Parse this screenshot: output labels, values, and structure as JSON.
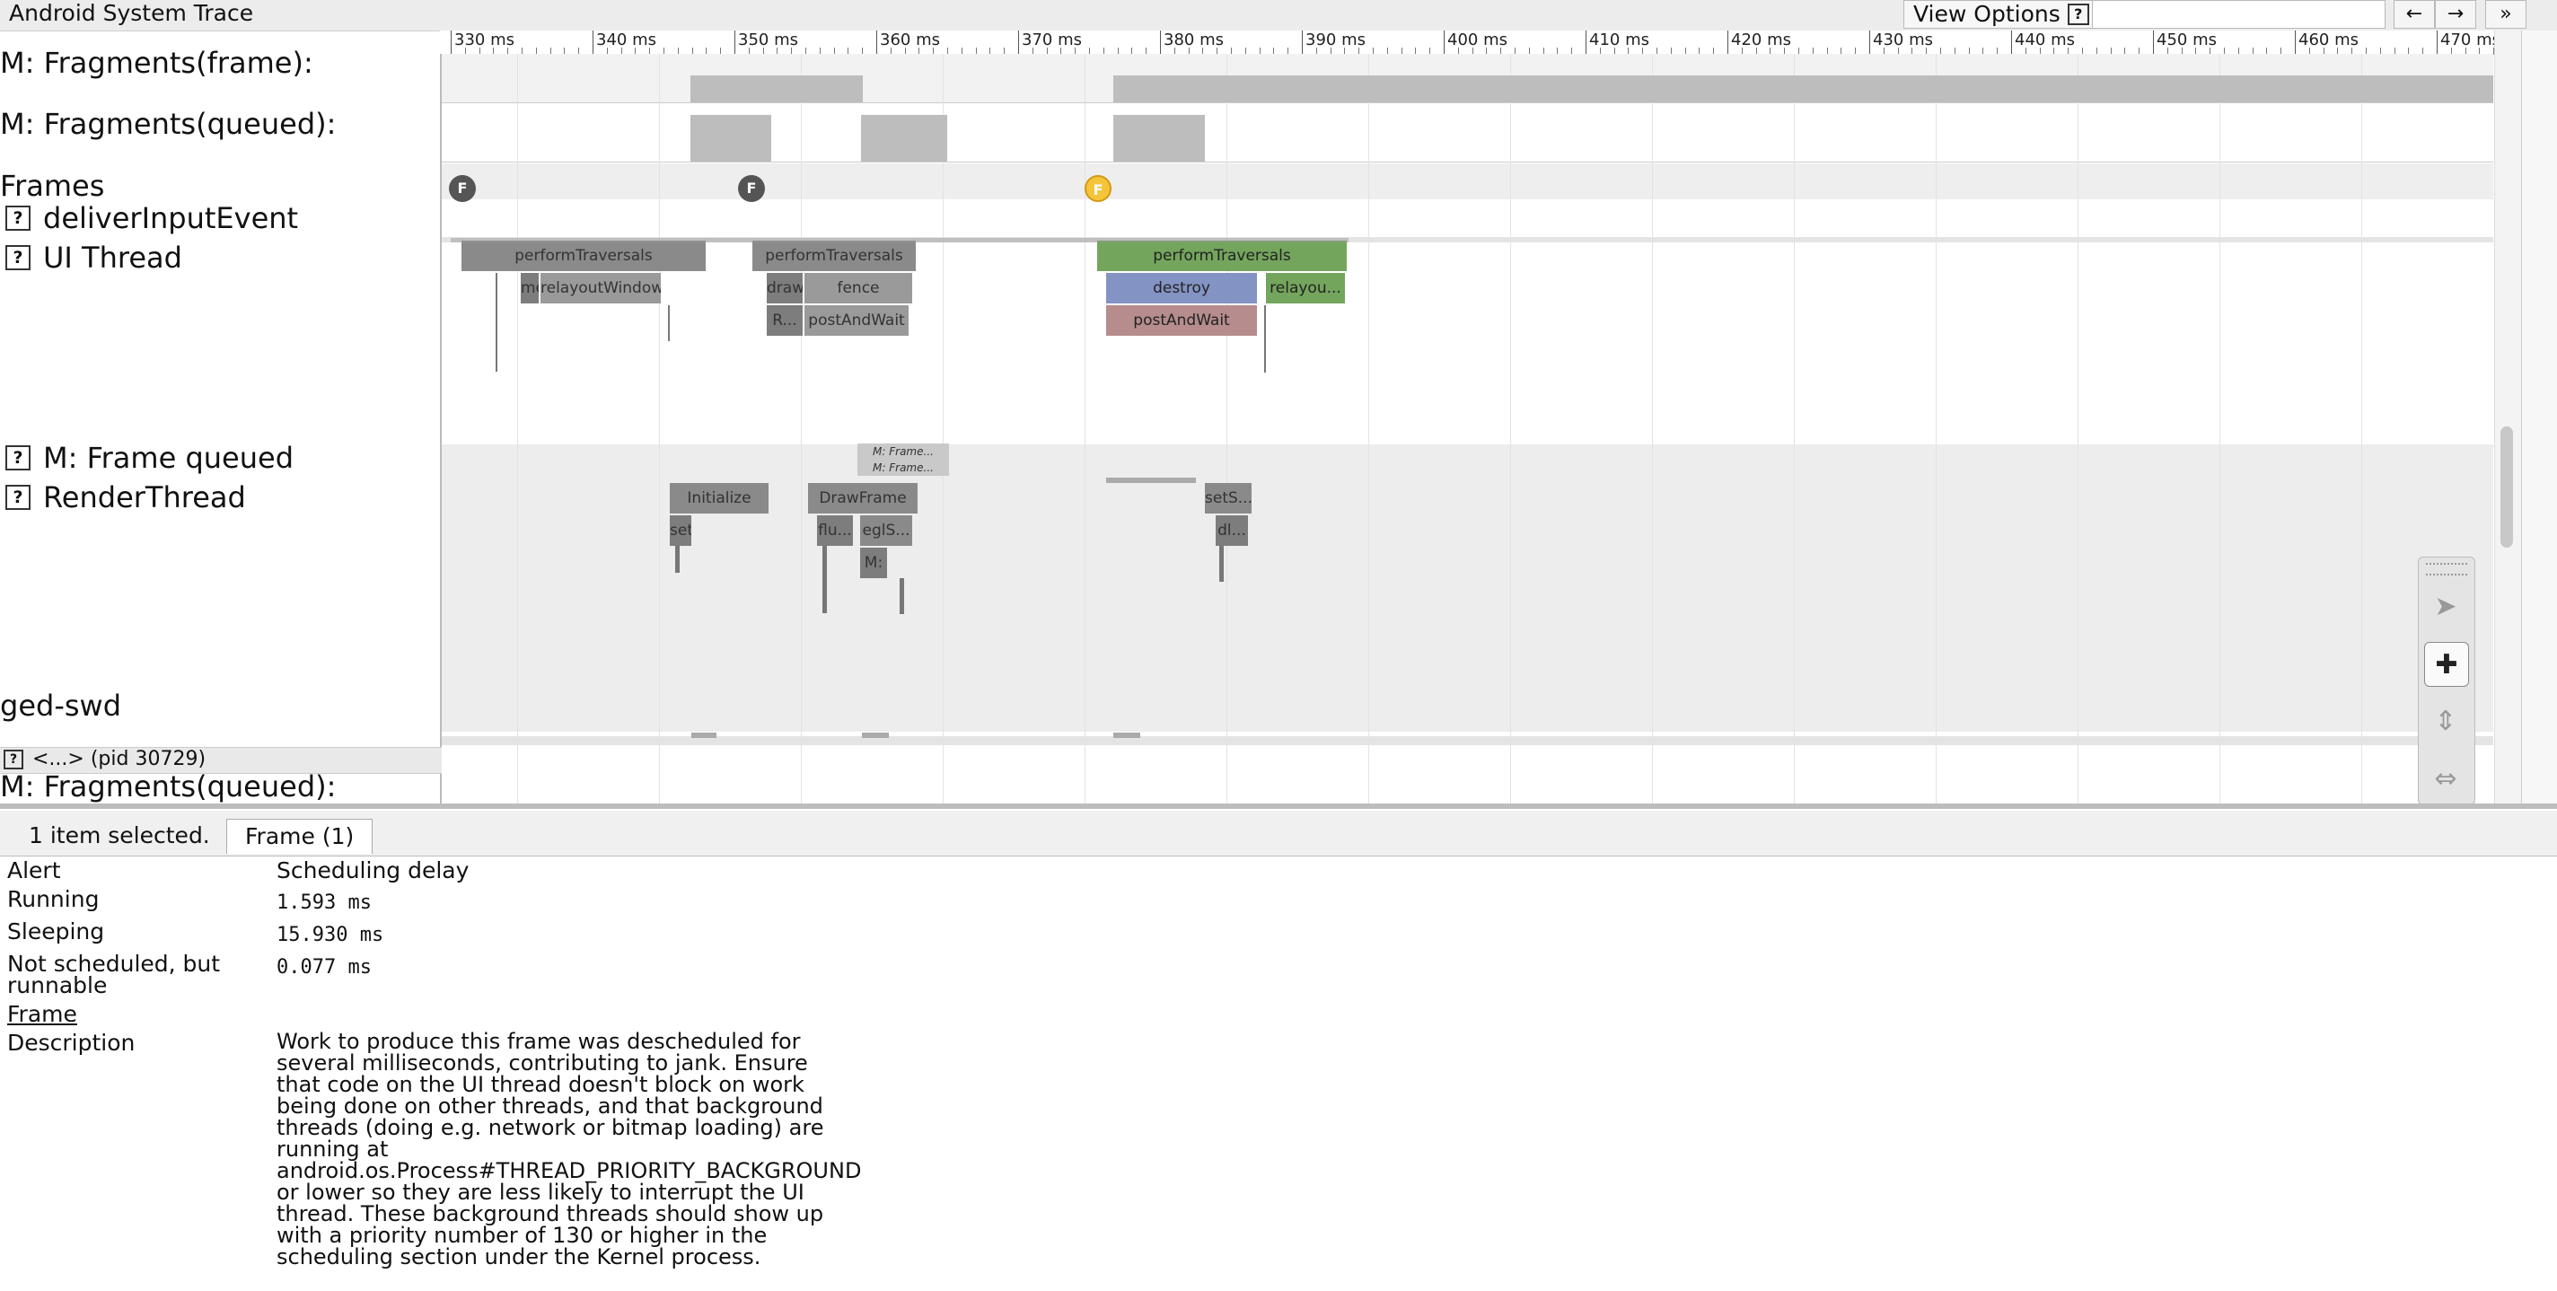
{
  "app_title": "Android System Trace",
  "toolbar": {
    "view_options_label": "View Options",
    "help_icon_label": "?",
    "prev_label": "←",
    "next_label": "→",
    "more_label": "»"
  },
  "ruler": {
    "ticks": [
      "330 ms",
      "340 ms",
      "350 ms",
      "360 ms",
      "370 ms",
      "380 ms",
      "390 ms",
      "400 ms",
      "410 ms",
      "420 ms",
      "430 ms",
      "440 ms",
      "450 ms",
      "460 ms",
      "470 ms"
    ]
  },
  "tracks": {
    "fragments_frame": "M: Fragments(frame):",
    "fragments_queued": "M: Fragments(queued):",
    "frames": "Frames",
    "deliver_input": "deliverInputEvent",
    "ui_thread": "UI Thread",
    "frame_queued": "M: Frame queued",
    "render_thread": "RenderThread",
    "process_name": "ged-swd",
    "pid_label": "<...> (pid 30729)",
    "fragments_queued_2": "M: Fragments(queued):"
  },
  "frame_markers": [
    "F",
    "F",
    "F"
  ],
  "slices": {
    "ui": {
      "perform1": "performTraversals",
      "me": "me",
      "relayout": "relayoutWindow",
      "perform2": "performTraversals",
      "draw": "draw",
      "fence": "fence",
      "r": "R...",
      "postwait1": "postAndWait",
      "perform3": "performTraversals",
      "destroy": "destroy",
      "relayou": "relayou...",
      "postwait2": "postAndWait"
    },
    "frame_queued": {
      "q1": "M: Frame...",
      "q2": "M: Frame..."
    },
    "render": {
      "initialize": "Initialize",
      "set": "set",
      "drawframe": "DrawFrame",
      "flu": "flu...",
      "egls": "eglS...",
      "m": "M:",
      "sets": "setS...",
      "dl": "dl..."
    }
  },
  "details": {
    "selection_count": "1 item selected.",
    "tab_label": "Frame (1)",
    "rows": {
      "alert_label": "Alert",
      "alert_value": "Scheduling delay",
      "running_label": "Running",
      "running_value": "1.593 ms",
      "sleeping_label": "Sleeping",
      "sleeping_value": "15.930 ms",
      "runnable_label_1": "Not scheduled, but",
      "runnable_label_2": "runnable",
      "runnable_value": "0.077 ms",
      "frame_link": "Frame",
      "description_label": "Description"
    },
    "description_lines": [
      "Work to produce this frame was descheduled for",
      "several milliseconds, contributing to jank. Ensure",
      "that code on the UI thread doesn't block on work",
      "being done on other threads, and that background",
      "threads (doing e.g. network or bitmap loading) are",
      "running at",
      "android.os.Process#THREAD_PRIORITY_BACKGROUND",
      "or lower so they are less likely to interrupt the UI",
      "thread. These background threads should show up",
      "with a priority number of 130 or higher in the",
      "scheduling section under the Kernel process."
    ]
  },
  "colors": {
    "slice_grey": "#8a8a8a",
    "slice_green": "#74a55d",
    "slice_blue": "#8393c3",
    "slice_red": "#b68c8c",
    "frame_dot_grey": "#555555",
    "frame_dot_yellow": "#f5c43b"
  }
}
